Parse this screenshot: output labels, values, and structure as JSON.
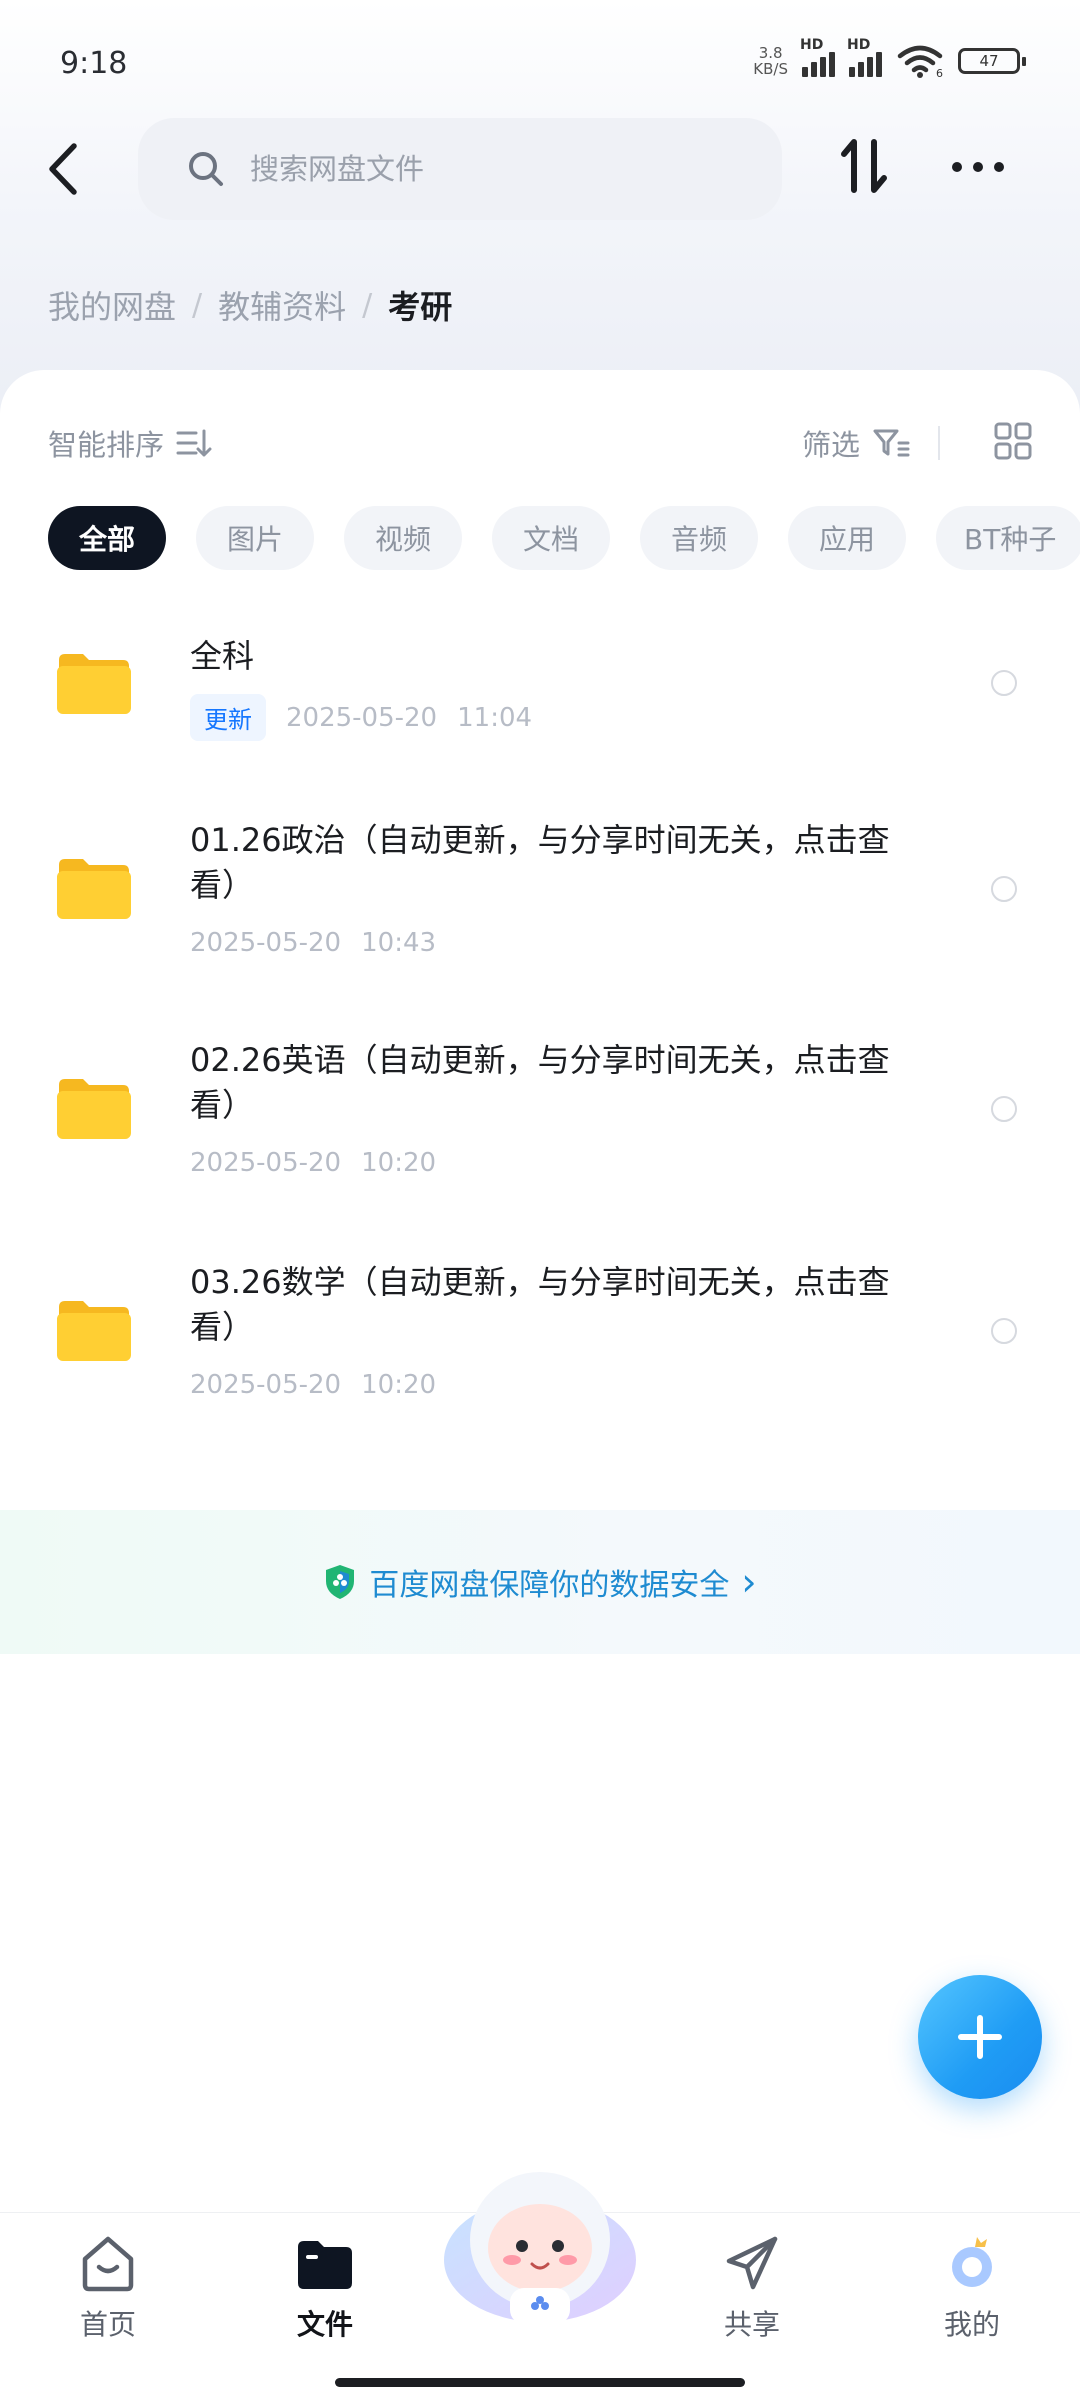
{
  "status_bar": {
    "time": "9:18",
    "net_speed": "3.8/\nKB/S",
    "net_speed_value": "3.8",
    "net_speed_unit": "KB/S",
    "signal1_label": "HD",
    "signal2_label": "HD",
    "wifi_sub": "6",
    "battery": "47"
  },
  "header": {
    "search_placeholder": "搜索网盘文件"
  },
  "breadcrumb": {
    "items": [
      "我的网盘",
      "教辅资料",
      "考研"
    ],
    "separator": "/"
  },
  "toolbar": {
    "sort_label": "智能排序",
    "filter_label": "筛选"
  },
  "chips": [
    "全部",
    "图片",
    "视频",
    "文档",
    "音频",
    "应用",
    "BT种子"
  ],
  "active_chip": 0,
  "files": [
    {
      "name": "全科",
      "badge": "更新",
      "date": "2025-05-20",
      "time": "11:04"
    },
    {
      "name": "01.26政治（自动更新，与分享时间无关，点击查看）",
      "date": "2025-05-20",
      "time": "10:43"
    },
    {
      "name": "02.26英语（自动更新，与分享时间无关，点击查看）",
      "date": "2025-05-20",
      "time": "10:20"
    },
    {
      "name": "03.26数学（自动更新，与分享时间无关，点击查看）",
      "date": "2025-05-20",
      "time": "10:20"
    }
  ],
  "security_banner": {
    "text": "百度网盘保障你的数据安全",
    "arrow": "›"
  },
  "bottom_nav": {
    "items": [
      "首页",
      "文件",
      "共享",
      "我的"
    ],
    "active": "文件"
  },
  "colors": {
    "accent": "#1677ff",
    "fab": "#1f9cf5",
    "folder": "#ffcf33",
    "chip_active_bg": "#0e1522"
  }
}
